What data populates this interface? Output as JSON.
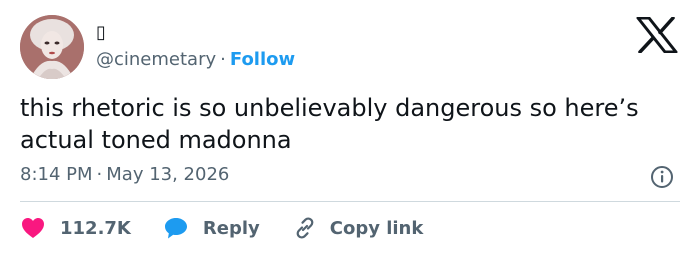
{
  "account": {
    "display_name": "▯",
    "handle": "@cinemetary",
    "separator": "·",
    "follow_label": "Follow"
  },
  "tweet": {
    "text": "this rhetoric is so unbelievably dangerous so here’s actual toned madonna",
    "time": "8:14 PM",
    "separator": "·",
    "date": "May 13, 2026"
  },
  "actions": {
    "likes": "112.7K",
    "reply_label": "Reply",
    "copy_label": "Copy link"
  },
  "colors": {
    "like": "#f91880",
    "reply": "#1d9bf0",
    "link": "#1d9bf0",
    "muted": "#536471",
    "text": "#0f1419"
  },
  "icons": {
    "brand": "x-logo-icon",
    "info": "info-icon",
    "like": "heart-icon",
    "reply": "speech-bubble-icon",
    "copy": "link-icon"
  }
}
